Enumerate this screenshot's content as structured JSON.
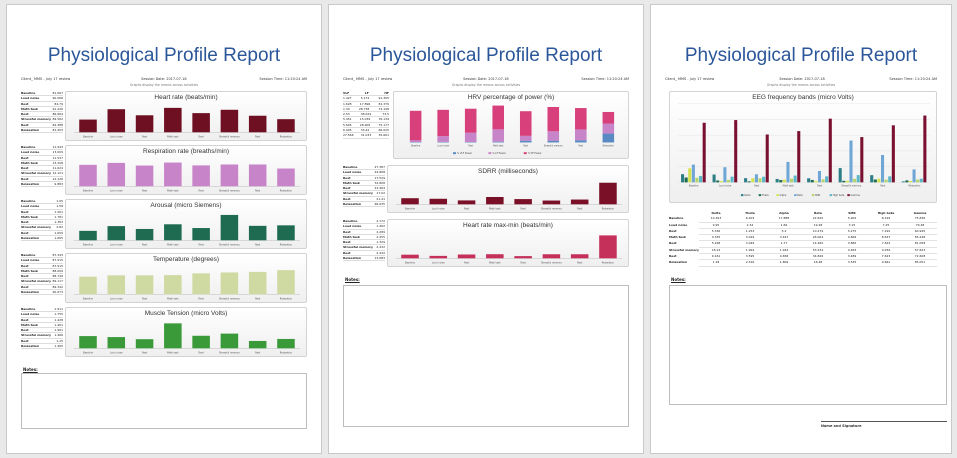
{
  "report_title": "Physiological Profile Report",
  "meta": {
    "client": "Client_ MMS - July 17 review",
    "session_date": "Session Date: 2017-07-18",
    "session_time": "Session Time: 11:20:24 AM",
    "subtitle": "Graphs display the means across activities"
  },
  "notes_label": "Notes:",
  "signature_label": "Name and Signature",
  "colors": {
    "title": "#2b579a",
    "heart_rate": "#6e0f22",
    "respiration": "#c784c9",
    "arousal": "#1e6b52",
    "temperature": "#cfd9a2",
    "muscle": "#3a9a3a",
    "hrv": "#d7407a",
    "sdrr": "#7a1028",
    "hr_maxmin": "#c4305a"
  },
  "stat_labels": [
    "Baseline",
    "Loud noise",
    "Rest",
    "Math task",
    "Rest",
    "Stressful memory",
    "Rest",
    "Relaxation"
  ],
  "stat_labels_long": [
    "Baseline",
    "Loud noise",
    "Rest",
    "Math task",
    "Rest",
    "Stressful memory",
    "Rest",
    "Relaxation"
  ],
  "page1": {
    "sections": [
      {
        "name": "heart-rate",
        "chart_title": "Heart rate (beats/min)",
        "color": "#6e0f22",
        "stats": [
          "81.067",
          "90.066",
          "84.79",
          "91.226",
          "86.664",
          "89.562",
          "84.388",
          "81.403"
        ],
        "chart_data": {
          "type": "bar",
          "categories": [
            "Baseline",
            "Loud noise",
            "Rest",
            "Math task",
            "Rest",
            "Stressful memory",
            "Rest",
            "Relaxation"
          ],
          "values": [
            81.067,
            90.066,
            84.79,
            91.226,
            86.664,
            89.562,
            84.388,
            81.403
          ],
          "ylim": [
            70,
            95
          ]
        }
      },
      {
        "name": "respiration-rate",
        "chart_title": "Respiration rate (breaths/min)",
        "color": "#c784c9",
        "stats": [
          "11.943",
          "13.009",
          "11.537",
          "13.208",
          "11.624",
          "12.121",
          "12.126",
          "9.883"
        ],
        "chart_data": {
          "type": "bar",
          "categories": [
            "Baseline",
            "Loud noise",
            "Rest",
            "Math task",
            "Rest",
            "Stressful memory",
            "Rest",
            "Relaxation"
          ],
          "values": [
            11.943,
            13.009,
            11.537,
            13.208,
            11.624,
            12.121,
            12.126,
            9.883
          ],
          "ylim": [
            0,
            16
          ]
        }
      },
      {
        "name": "arousal",
        "chart_title": "Arousal (micro Siemens)",
        "color": "#1e6b52",
        "stats": [
          "1.05",
          "1.58",
          "1.261",
          "1.781",
          "1.363",
          "2.82",
          "1.609",
          "1.665"
        ],
        "chart_data": {
          "type": "bar",
          "categories": [
            "Baseline",
            "Loud noise",
            "Rest",
            "Math task",
            "Rest",
            "Stressful memory",
            "Rest",
            "Relaxation"
          ],
          "values": [
            1.05,
            1.58,
            1.261,
            1.781,
            1.363,
            2.82,
            1.609,
            1.665
          ],
          "ylim": [
            0,
            3.2
          ]
        }
      },
      {
        "name": "temperature",
        "chart_title": "Temperature (degrees)",
        "color": "#cfd9a2",
        "stats": [
          "87.343",
          "87.915",
          "87.915",
          "88.009",
          "88.749",
          "89.117",
          "89.342",
          "90.073"
        ],
        "chart_data": {
          "type": "bar",
          "categories": [
            "Baseline",
            "Loud noise",
            "Rest",
            "Math task",
            "Rest",
            "Stressful memory",
            "Rest",
            "Relaxation"
          ],
          "values": [
            87.343,
            87.915,
            87.915,
            88.009,
            88.749,
            89.117,
            89.342,
            90.073
          ],
          "ylim": [
            80,
            92
          ]
        }
      },
      {
        "name": "muscle-tension",
        "chart_title": "Muscle Tension (micro Volts)",
        "color": "#3a9a3a",
        "stats": [
          "1.911",
          "1.755",
          "1.428",
          "1.461",
          "1.961",
          "1.466",
          "1.15",
          "1.465"
        ],
        "chart_data": {
          "type": "bar",
          "categories": [
            "Baseline",
            "Loud noise",
            "Rest",
            "Math task",
            "Rest",
            "Stressful memory",
            "Rest",
            "Relaxation"
          ],
          "values": [
            1.911,
            1.755,
            1.428,
            3.9,
            1.961,
            2.3,
            1.15,
            1.465
          ],
          "ylim": [
            0,
            4.5
          ]
        }
      }
    ]
  },
  "page2": {
    "hrv": {
      "chart_title": "HRV percentage of power (%)",
      "table_header": [
        "VLF",
        "LF",
        "HF"
      ],
      "table_rows": [
        [
          "1.427",
          "5.174",
          "91.305"
        ],
        [
          "1.628",
          "17.896",
          "81.376"
        ],
        [
          "1.39",
          "28.738",
          "74.198"
        ],
        [
          "2.53",
          "38.029",
          "73.5"
        ],
        [
          "5.451",
          "15.039",
          "76.139"
        ],
        [
          "5.605",
          "28.905",
          "75.177"
        ],
        [
          "6.905",
          "33.42",
          "66.025"
        ],
        [
          "27.566",
          "31.033",
          "35.661"
        ]
      ],
      "legend": [
        "% VLF Power",
        "% LF Power",
        "% HF Power"
      ],
      "chart_data": {
        "type": "bar",
        "categories": [
          "Baseline",
          "Loud noise",
          "Rest",
          "Math task",
          "Rest",
          "Stressful memory",
          "Rest",
          "Relaxation"
        ],
        "series": [
          {
            "name": "% VLF Power",
            "values": [
              1.427,
              1.628,
              1.39,
              2.53,
              5.451,
              5.605,
              6.905,
              27.566
            ]
          },
          {
            "name": "% LF Power",
            "values": [
              5.174,
              17.896,
              28.738,
              38.029,
              15.039,
              28.905,
              33.42,
              31.033
            ]
          },
          {
            "name": "% HF Power",
            "values": [
              91.305,
              81.376,
              74.198,
              73.5,
              76.139,
              75.177,
              66.025,
              35.661
            ]
          }
        ],
        "ylim": [
          0,
          120
        ]
      }
    },
    "sdrr": {
      "chart_title": "SDRR (milliseconds)",
      "stats": [
        "27.387",
        "24.868",
        "17.529",
        "32.808",
        "23.464",
        "17.02",
        "21.41",
        "96.635"
      ],
      "chart_data": {
        "type": "bar",
        "categories": [
          "Baseline",
          "Loud noise",
          "Rest",
          "Math task",
          "Rest",
          "Stressful memory",
          "Rest",
          "Relaxation"
        ],
        "values": [
          27.387,
          24.868,
          17.529,
          32.808,
          23.464,
          17.02,
          21.41,
          96.635
        ],
        "ylim": [
          0,
          120
        ]
      }
    },
    "hr_maxmin": {
      "chart_title": "Heart rate max-min (beats/min)",
      "stats": [
        "2.172",
        "1.462",
        "2.289",
        "2.455",
        "1.329",
        "2.432",
        "2.432",
        "13.683"
      ],
      "chart_data": {
        "type": "bar",
        "categories": [
          "Baseline",
          "Loud noise",
          "Rest",
          "Math task",
          "Rest",
          "Stressful memory",
          "Rest",
          "Relaxation"
        ],
        "values": [
          2.172,
          1.462,
          2.289,
          2.455,
          1.329,
          2.432,
          2.432,
          13.683
        ],
        "ylim": [
          0,
          16
        ]
      }
    }
  },
  "page3": {
    "eeg": {
      "chart_title": "EEG frequency bands (micro Volts)",
      "legend": [
        "Delta",
        "Theta",
        "Alpha",
        "Beta",
        "SMR",
        "High beta",
        "Gamma"
      ],
      "table_header": [
        "Delta",
        "Theta",
        "Alpha",
        "Beta",
        "SMR",
        "High beta",
        "Gamma"
      ],
      "table_rows": [
        [
          "10.393",
          "6.203",
          "17.888",
          "22.625",
          "5.902",
          "8.192",
          "75.836"
        ],
        [
          "9.95",
          "2.34",
          "1.69",
          "19.28",
          "3.15",
          "7.25",
          "79.28"
        ],
        [
          "5.336",
          "1.253",
          "5.2",
          "10.279",
          "5.275",
          "7.192",
          "60.945"
        ],
        [
          "4.335",
          "3.029",
          "3.447",
          "26.064",
          "4.669",
          "8.637",
          "65.248"
        ],
        [
          "5.168",
          "3.049",
          "1.77",
          "14.465",
          "3.882",
          "7.622",
          "81.058"
        ],
        [
          "18.14",
          "1.994",
          "1.944",
          "53.234",
          "4.463",
          "9.259",
          "57.623"
        ],
        [
          "9.161",
          "3.595",
          "4.658",
          "34.826",
          "3.489",
          "7.623",
          "72.608"
        ],
        [
          "1.18",
          "2.516",
          "1.809",
          "16.48",
          "3.535",
          "4.661",
          "85.051"
        ]
      ],
      "chart_data": {
        "type": "bar",
        "categories": [
          "Baseline",
          "Loud noise",
          "Rest",
          "Math task",
          "Rest",
          "Stressful memory",
          "Rest",
          "Relaxation"
        ],
        "series": [
          {
            "name": "Delta",
            "values": [
              10.393,
              9.95,
              5.336,
              4.335,
              5.168,
              18.14,
              9.161,
              1.18
            ]
          },
          {
            "name": "Theta",
            "values": [
              6.203,
              2.34,
              1.253,
              3.029,
              3.049,
              1.994,
              3.595,
              2.516
            ]
          },
          {
            "name": "Alpha",
            "values": [
              17.888,
              1.69,
              5.2,
              3.447,
              1.77,
              1.944,
              4.658,
              1.809
            ]
          },
          {
            "name": "Beta",
            "values": [
              22.625,
              19.28,
              10.279,
              26.064,
              14.465,
              53.234,
              34.826,
              16.48
            ]
          },
          {
            "name": "SMR",
            "values": [
              5.902,
              3.15,
              5.275,
              4.669,
              3.882,
              4.463,
              3.489,
              3.535
            ]
          },
          {
            "name": "High beta",
            "values": [
              8.192,
              7.25,
              7.192,
              8.637,
              7.622,
              9.259,
              7.623,
              4.661
            ]
          },
          {
            "name": "Gamma",
            "values": [
              75.836,
              79.28,
              60.945,
              65.248,
              81.058,
              57.623,
              72.608,
              85.051
            ]
          }
        ],
        "colors": [
          "#2b7d86",
          "#1e6b52",
          "#d4e24e",
          "#6fa6d6",
          "#b6d36a",
          "#5ab6c8",
          "#7a1030"
        ],
        "ylim": [
          0,
          100
        ]
      }
    }
  }
}
